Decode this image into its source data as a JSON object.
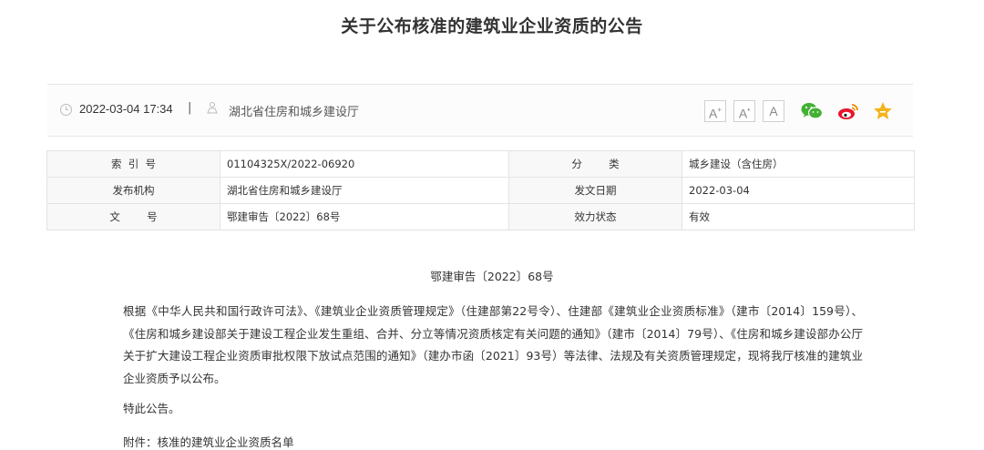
{
  "page": {
    "title": "关于公布核准的建筑业企业资质的公告"
  },
  "infobar": {
    "date": "2022-03-04 17:34",
    "separator": "|",
    "organization": "湖北省住房和城乡建设厅",
    "font_buttons": [
      "A+",
      "A",
      "A-"
    ],
    "share_icons": [
      "wechat-icon",
      "weibo-icon",
      "favorite-star-icon"
    ],
    "colors": {
      "wechat": "#44b035",
      "weibo": "#e6162d",
      "star": "#f5b31a"
    }
  },
  "meta_table": {
    "rows": [
      {
        "label1": "索  引  号",
        "value1": "01104325X/2022-06920",
        "label2": "分        类",
        "value2": "城乡建设（含住房）"
      },
      {
        "label1": "发布机构",
        "value1": "湖北省住房和城乡建设厅",
        "label2": "发文日期",
        "value2": "2022-03-04"
      },
      {
        "label1": "文        号",
        "value1": "鄂建审告〔2022〕68号",
        "label2": "效力状态",
        "value2": "有效"
      }
    ]
  },
  "content": {
    "doc_number": "鄂建审告〔2022〕68号",
    "paragraph": "根据《中华人民共和国行政许可法》、《建筑业企业资质管理规定》（住建部第22号令）、住建部《建筑业企业资质标准》（建市〔2014〕159号）、《住房和城乡建设部关于建设工程企业发生重组、合并、分立等情况资质核定有关问题的通知》（建市〔2014〕79号）、《住房和城乡建设部办公厅关于扩大建设工程企业资质审批权限下放试点范围的通知》（建办市函〔2021〕93号）等法律、法规及有关资质管理规定，现将我厅核准的建筑业企业资质予以公布。",
    "closing": "特此公告。",
    "attachment": "附件：核准的建筑业企业资质名单"
  }
}
